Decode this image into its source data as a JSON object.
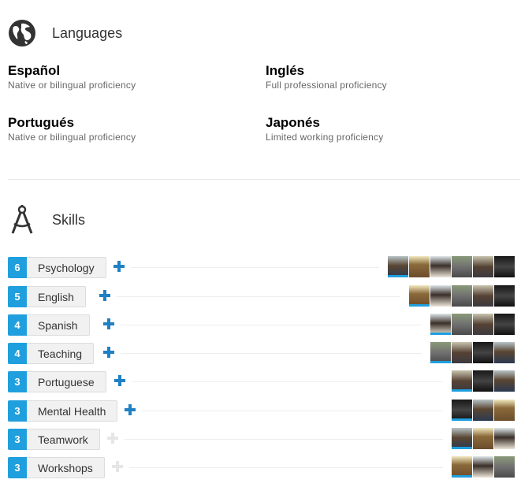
{
  "languages": {
    "title": "Languages",
    "items": [
      {
        "name": "Español",
        "level": "Native or bilingual proficiency"
      },
      {
        "name": "Inglés",
        "level": "Full professional proficiency"
      },
      {
        "name": "Portugués",
        "level": "Native or bilingual proficiency"
      },
      {
        "name": "Japonés",
        "level": "Limited working proficiency"
      }
    ]
  },
  "skills": {
    "title": "Skills",
    "items": [
      {
        "count": "6",
        "name": "Psychology",
        "endorse_enabled": true,
        "endorser_count": 6
      },
      {
        "count": "5",
        "name": "English",
        "endorse_enabled": true,
        "endorser_count": 5
      },
      {
        "count": "4",
        "name": "Spanish",
        "endorse_enabled": true,
        "endorser_count": 4
      },
      {
        "count": "4",
        "name": "Teaching",
        "endorse_enabled": true,
        "endorser_count": 4
      },
      {
        "count": "3",
        "name": "Portuguese",
        "endorse_enabled": true,
        "endorser_count": 3
      },
      {
        "count": "3",
        "name": "Mental Health",
        "endorse_enabled": true,
        "endorser_count": 3
      },
      {
        "count": "3",
        "name": "Teamwork",
        "endorse_enabled": false,
        "endorser_count": 3
      },
      {
        "count": "3",
        "name": "Workshops",
        "endorse_enabled": false,
        "endorser_count": 3
      }
    ]
  },
  "icons": {
    "languages": "globe-icon",
    "skills": "compass-icon",
    "endorse": "plus-icon"
  },
  "colors": {
    "count_badge": "#1f9fde",
    "endorse_plus": "#1f80c4",
    "endorse_plus_disabled": "#e6e6e6"
  }
}
